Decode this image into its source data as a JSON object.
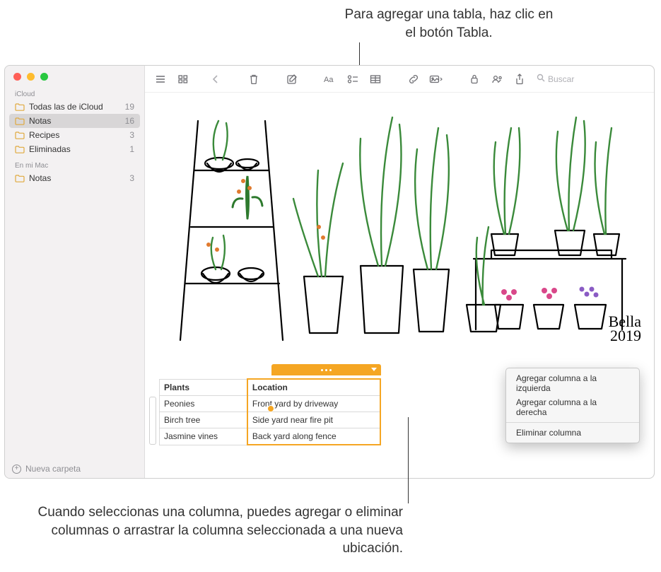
{
  "callouts": {
    "top": "Para agregar una tabla, haz clic en el botón Tabla.",
    "bottom": "Cuando seleccionas una columna, puedes agregar o eliminar columnas o arrastrar la columna seleccionada a una nueva ubicación."
  },
  "sidebar": {
    "sections": [
      {
        "label": "iCloud",
        "folders": [
          {
            "name": "Todas las de iCloud",
            "count": "19",
            "selected": false
          },
          {
            "name": "Notas",
            "count": "16",
            "selected": true
          },
          {
            "name": "Recipes",
            "count": "3",
            "selected": false
          },
          {
            "name": "Eliminadas",
            "count": "1",
            "selected": false
          }
        ]
      },
      {
        "label": "En mi Mac",
        "folders": [
          {
            "name": "Notas",
            "count": "3",
            "selected": false
          }
        ]
      }
    ],
    "new_folder": "Nueva carpeta"
  },
  "toolbar": {
    "search_placeholder": "Buscar"
  },
  "signature": {
    "name": "Bella",
    "year": "2019"
  },
  "note_table": {
    "headers": [
      "Plants",
      "Location"
    ],
    "rows": [
      [
        "Peonies",
        "Front yard by driveway"
      ],
      [
        "Birch tree",
        "Side yard near fire pit"
      ],
      [
        "Jasmine vines",
        "Back yard along fence"
      ]
    ],
    "selected_column_index": 1
  },
  "context_menu": {
    "items": [
      "Agregar columna a la izquierda",
      "Agregar columna a la derecha"
    ],
    "delete": "Eliminar columna"
  },
  "colors": {
    "accent": "#f5a623",
    "folder_icon": "#e0a93e"
  }
}
